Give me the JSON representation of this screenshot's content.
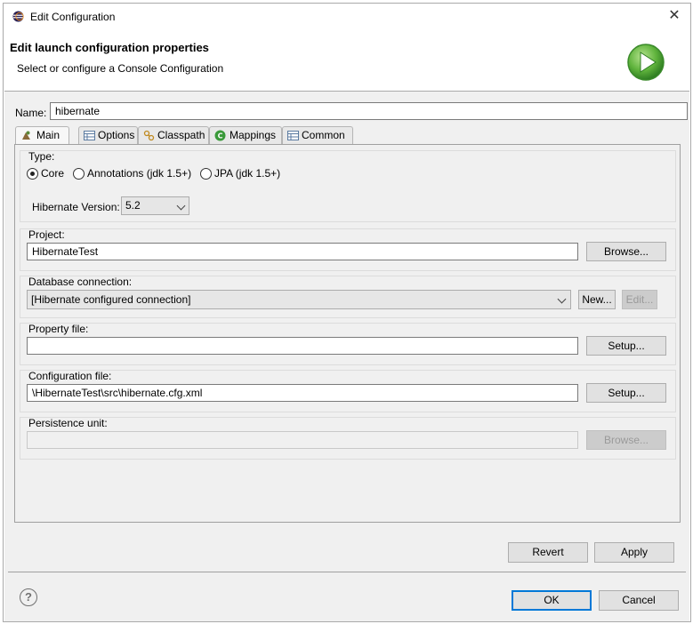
{
  "window": {
    "title": "Edit Configuration",
    "close_icon": "close-icon",
    "app_icon": "eclipse-icon"
  },
  "header": {
    "title": "Edit launch configuration properties",
    "subtitle": "Select or configure a Console Configuration",
    "icon": "run-icon"
  },
  "name": {
    "label": "Name:",
    "value": "hibernate"
  },
  "tabs": [
    {
      "label": "Main",
      "icon": "main-icon",
      "active": true
    },
    {
      "label": "Options",
      "icon": "options-icon",
      "active": false
    },
    {
      "label": "Classpath",
      "icon": "classpath-icon",
      "active": false
    },
    {
      "label": "Mappings",
      "icon": "mappings-icon",
      "active": false
    },
    {
      "label": "Common",
      "icon": "common-icon",
      "active": false
    }
  ],
  "type_group": {
    "label": "Type:",
    "options": [
      {
        "label": "Core",
        "selected": true
      },
      {
        "label": "Annotations (jdk 1.5+)",
        "selected": false
      },
      {
        "label": "JPA (jdk 1.5+)",
        "selected": false
      }
    ],
    "hibernate_version_label": "Hibernate Version:",
    "hibernate_version_value": "5.2"
  },
  "project_group": {
    "label": "Project:",
    "value": "HibernateTest",
    "browse_label": "Browse..."
  },
  "db_group": {
    "label": "Database connection:",
    "value": "[Hibernate configured connection]",
    "new_label": "New...",
    "edit_label": "Edit..."
  },
  "property_group": {
    "label": "Property file:",
    "value": "",
    "setup_label": "Setup..."
  },
  "config_group": {
    "label": "Configuration file:",
    "value": "\\HibernateTest\\src\\hibernate.cfg.xml",
    "setup_label": "Setup..."
  },
  "persistence_group": {
    "label": "Persistence unit:",
    "value": "",
    "browse_label": "Browse..."
  },
  "buttons": {
    "revert": "Revert",
    "apply": "Apply",
    "ok": "OK",
    "cancel": "Cancel",
    "help": "?"
  },
  "colors": {
    "accent": "#0078d7",
    "run_green": "#4caf3a"
  }
}
